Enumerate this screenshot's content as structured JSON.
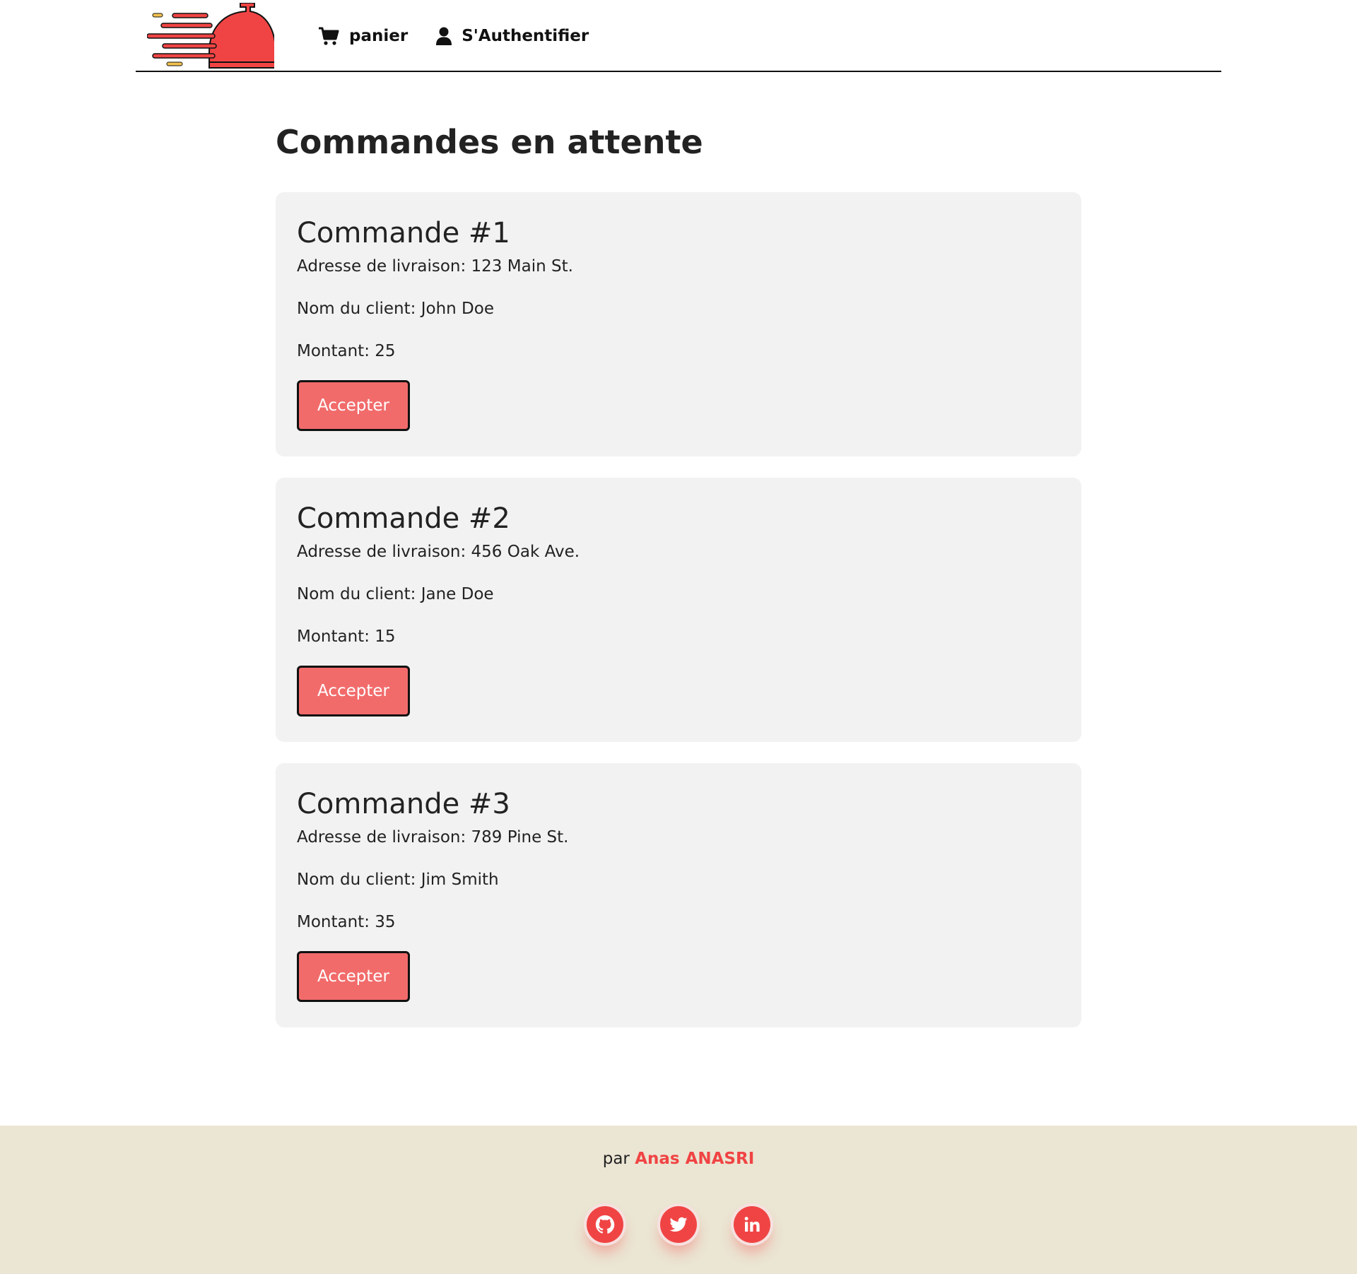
{
  "nav": {
    "cart_label": "panier",
    "login_label": "S'Authentifier"
  },
  "main": {
    "title": "Commandes en attente",
    "orders": [
      {
        "title": "Commande #1",
        "address": "Adresse de livraison: 123 Main St.",
        "client": "Nom du client: John Doe",
        "amount": "Montant: 25",
        "button": "Accepter"
      },
      {
        "title": "Commande #2",
        "address": "Adresse de livraison: 456 Oak Ave.",
        "client": "Nom du client: Jane Doe",
        "amount": "Montant: 15",
        "button": "Accepter"
      },
      {
        "title": "Commande #3",
        "address": "Adresse de livraison: 789 Pine St.",
        "client": "Nom du client: Jim Smith",
        "amount": "Montant: 35",
        "button": "Accepter"
      }
    ]
  },
  "footer": {
    "by": "par",
    "author": "Anas ANASRI",
    "socials": [
      "github-icon",
      "twitter-icon",
      "linkedin-icon"
    ]
  },
  "colors": {
    "accent": "#f04444",
    "button": "#f26b6b",
    "card": "#f2f2f2",
    "footer": "#ebe5d3"
  }
}
